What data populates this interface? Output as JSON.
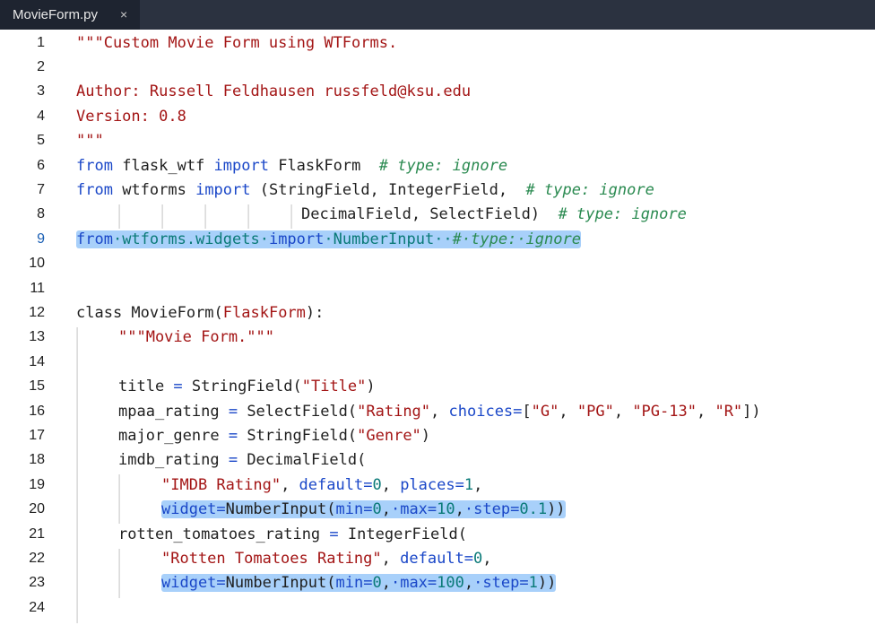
{
  "tab": {
    "filename": "MovieForm.py",
    "close_glyph": "×"
  },
  "lines": [
    {
      "no": "1"
    },
    {
      "no": "2"
    },
    {
      "no": "3"
    },
    {
      "no": "4"
    },
    {
      "no": "5"
    },
    {
      "no": "6"
    },
    {
      "no": "7"
    },
    {
      "no": "8"
    },
    {
      "no": "9"
    },
    {
      "no": "10"
    },
    {
      "no": "11"
    },
    {
      "no": "12"
    },
    {
      "no": "13"
    },
    {
      "no": "14"
    },
    {
      "no": "15"
    },
    {
      "no": "16"
    },
    {
      "no": "17"
    },
    {
      "no": "18"
    },
    {
      "no": "19"
    },
    {
      "no": "20"
    },
    {
      "no": "21"
    },
    {
      "no": "22"
    },
    {
      "no": "23"
    },
    {
      "no": "24"
    }
  ],
  "code": {
    "l1": "\"\"\"Custom Movie Form using WTForms.",
    "l3": "Author: Russell Feldhausen russfeld@ksu.edu",
    "l4": "Version: 0.8",
    "l5": "\"\"\"",
    "from": "from",
    "import": "import",
    "flask_wtf": " flask_wtf ",
    "flaskform": " FlaskForm  ",
    "type_ignore": "# type: ignore",
    "wtforms": " wtforms ",
    "l7_rest": " (StringField, IntegerField,  ",
    "l8_rest": "DecimalField, SelectField)  ",
    "l9_from": "from",
    "l9_mod": "·wtforms.widgets·",
    "l9_import": "import",
    "l9_name": "·NumberInput··",
    "l9_comment": "#·type:·ignore",
    "class_kw": "class",
    "class_name": " MovieForm(",
    "class_base": "FlaskForm",
    "class_end": "):",
    "l13": "\"\"\"Movie Form.\"\"\"",
    "l15_a": "title ",
    "eq": "=",
    "l15_b": " StringField(",
    "l15_s": "\"Title\"",
    "close": ")",
    "l16_a": "mpaa_rating ",
    "l16_b": " SelectField(",
    "l16_s": "\"Rating\"",
    "comma": ", ",
    "choices": "choices",
    "lbr": "[",
    "g": "\"G\"",
    "pg": "\"PG\"",
    "pg13": "\"PG-13\"",
    "r": "\"R\"",
    "rbr": "])",
    "l17_a": "major_genre ",
    "l17_b": " StringField(",
    "l17_s": "\"Genre\"",
    "l18_a": "imdb_rating ",
    "l18_b": " DecimalField(",
    "l19_s": "\"IMDB Rating\"",
    "default": "default",
    "zero": "0",
    "places": "places",
    "one": "1",
    "comma_end": ",",
    "widget": "widget",
    "numinput": "NumberInput(",
    "min": "min",
    "max": "·max",
    "step": "·step",
    "ten": "10",
    "hundred": "100",
    "pointone": "0.1",
    "comma_dot": ",",
    "close2": "))",
    "l21_a": "rotten_tomatoes_rating ",
    "l21_b": " IntegerField(",
    "l22_s": "\"Rotten Tomatoes Rating\""
  }
}
